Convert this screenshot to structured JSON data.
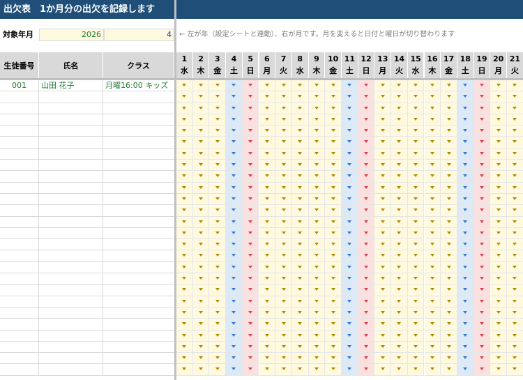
{
  "title": "出欠表　1か月分の出欠を記録します",
  "month_selector": {
    "label": "対象年月",
    "year": "2026",
    "month": "4"
  },
  "note": "← 左が年（設定シートと連動）、右が月です。月を変えると日付と曜日が切り替わります",
  "headers": {
    "student_id": "生徒番号",
    "name": "氏名",
    "class": "クラス"
  },
  "days": [
    {
      "day": "1",
      "weekday": "水"
    },
    {
      "day": "2",
      "weekday": "木"
    },
    {
      "day": "3",
      "weekday": "金"
    },
    {
      "day": "4",
      "weekday": "土"
    },
    {
      "day": "5",
      "weekday": "日"
    },
    {
      "day": "6",
      "weekday": "月"
    },
    {
      "day": "7",
      "weekday": "火"
    },
    {
      "day": "8",
      "weekday": "水"
    },
    {
      "day": "9",
      "weekday": "木"
    },
    {
      "day": "10",
      "weekday": "金"
    },
    {
      "day": "11",
      "weekday": "土"
    },
    {
      "day": "12",
      "weekday": "日"
    },
    {
      "day": "13",
      "weekday": "月"
    },
    {
      "day": "14",
      "weekday": "火"
    },
    {
      "day": "15",
      "weekday": "水"
    },
    {
      "day": "16",
      "weekday": "木"
    },
    {
      "day": "17",
      "weekday": "金"
    },
    {
      "day": "18",
      "weekday": "土"
    },
    {
      "day": "19",
      "weekday": "日"
    },
    {
      "day": "20",
      "weekday": "月"
    },
    {
      "day": "21",
      "weekday": "火"
    }
  ],
  "students": [
    {
      "id": "001",
      "name": "山田 花子",
      "class": "月曜16:00 キッズ"
    },
    {
      "id": "",
      "name": "",
      "class": ""
    },
    {
      "id": "",
      "name": "",
      "class": ""
    },
    {
      "id": "",
      "name": "",
      "class": ""
    },
    {
      "id": "",
      "name": "",
      "class": ""
    },
    {
      "id": "",
      "name": "",
      "class": ""
    },
    {
      "id": "",
      "name": "",
      "class": ""
    },
    {
      "id": "",
      "name": "",
      "class": ""
    },
    {
      "id": "",
      "name": "",
      "class": ""
    },
    {
      "id": "",
      "name": "",
      "class": ""
    },
    {
      "id": "",
      "name": "",
      "class": ""
    },
    {
      "id": "",
      "name": "",
      "class": ""
    },
    {
      "id": "",
      "name": "",
      "class": ""
    },
    {
      "id": "",
      "name": "",
      "class": ""
    },
    {
      "id": "",
      "name": "",
      "class": ""
    },
    {
      "id": "",
      "name": "",
      "class": ""
    },
    {
      "id": "",
      "name": "",
      "class": ""
    },
    {
      "id": "",
      "name": "",
      "class": ""
    },
    {
      "id": "",
      "name": "",
      "class": ""
    },
    {
      "id": "",
      "name": "",
      "class": ""
    },
    {
      "id": "",
      "name": "",
      "class": ""
    },
    {
      "id": "",
      "name": "",
      "class": ""
    },
    {
      "id": "",
      "name": "",
      "class": ""
    },
    {
      "id": "",
      "name": "",
      "class": ""
    },
    {
      "id": "",
      "name": "",
      "class": ""
    },
    {
      "id": "",
      "name": "",
      "class": ""
    }
  ],
  "colors": {
    "header_bar": "#1f4e79",
    "weekday_cell": "#fff9e0",
    "weekday_marker": "#b08900",
    "saturday_cell": "#dce9f7",
    "saturday_marker": "#3a78d0",
    "sunday_cell": "#fbe0e0",
    "sunday_marker": "#d9434f"
  }
}
